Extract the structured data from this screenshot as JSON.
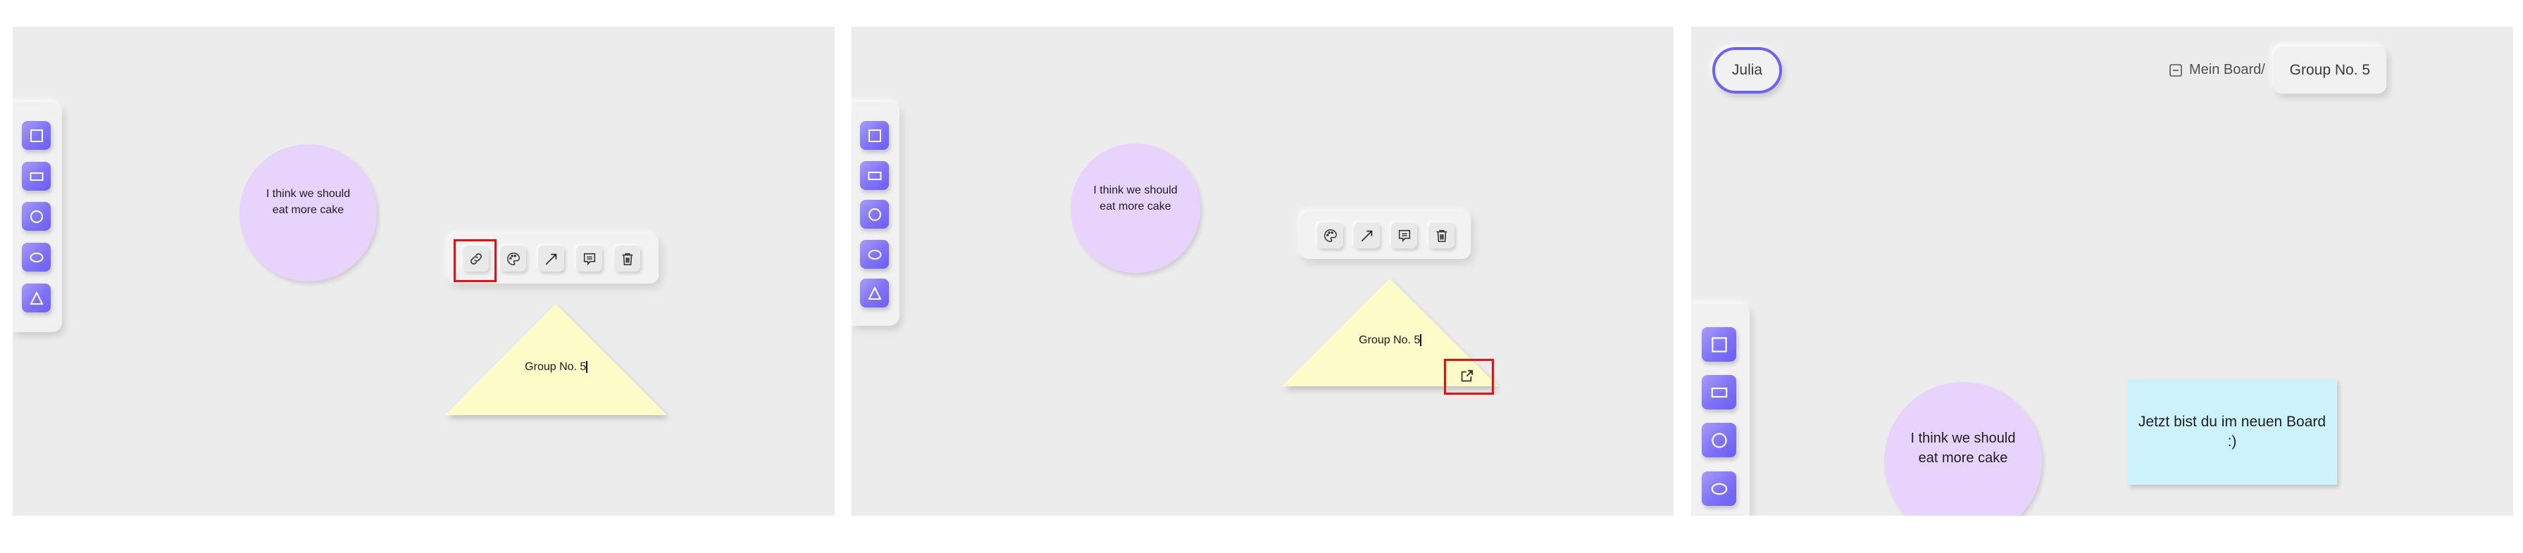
{
  "colors": {
    "canvas_bg": "#ececec",
    "tool_accent": "#7f72f7",
    "circle_fill": "#e8d3fc",
    "triangle_fill": "#fdfcc8",
    "note_fill": "#ccf3fc",
    "user_pill_border": "#6b61f5",
    "highlight": "#ea0f12"
  },
  "shape_tools": [
    {
      "name": "square",
      "icon": "square-icon"
    },
    {
      "name": "rectangle",
      "icon": "rectangle-icon"
    },
    {
      "name": "circle",
      "icon": "circle-icon"
    },
    {
      "name": "ellipse",
      "icon": "ellipse-icon"
    },
    {
      "name": "triangle",
      "icon": "triangle-icon"
    }
  ],
  "panels": [
    {
      "step": 1,
      "circle_note": {
        "lines": [
          "I think we should",
          "eat more cake"
        ]
      },
      "triangle_note": {
        "text": "Group No. 5"
      },
      "toolbar": {
        "buttons": [
          {
            "action": "link",
            "icon": "link-icon",
            "highlighted": true
          },
          {
            "action": "color",
            "icon": "palette-icon"
          },
          {
            "action": "connect",
            "icon": "arrow-icon"
          },
          {
            "action": "comment",
            "icon": "comment-icon"
          },
          {
            "action": "delete",
            "icon": "trash-icon"
          }
        ]
      }
    },
    {
      "step": 2,
      "circle_note": {
        "lines": [
          "I think we should",
          "eat more cake"
        ]
      },
      "triangle_note": {
        "text": "Group No. 5"
      },
      "toolbar": {
        "buttons": [
          {
            "action": "color",
            "icon": "palette-icon"
          },
          {
            "action": "connect",
            "icon": "arrow-icon"
          },
          {
            "action": "comment",
            "icon": "comment-icon"
          },
          {
            "action": "delete",
            "icon": "trash-icon"
          }
        ]
      },
      "open_link_button": {
        "icon": "open-external-icon",
        "highlighted": true
      }
    },
    {
      "step": 3,
      "user": {
        "name": "Julia"
      },
      "breadcrumb": {
        "root": "Mein Board/",
        "current": "Group No. 5"
      },
      "circle_note": {
        "lines": [
          "I think we should",
          "eat more cake"
        ]
      },
      "sticky_note": {
        "lines": [
          "Jetzt bist du im neuen Board",
          ":)"
        ]
      }
    }
  ]
}
